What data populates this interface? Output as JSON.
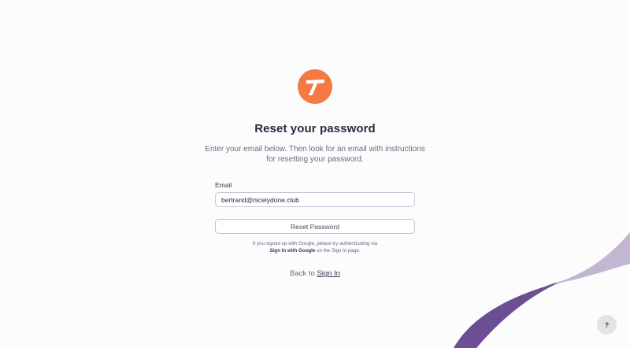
{
  "brand": {
    "logo_icon": "t-logo-icon",
    "accent_color": "#f47a45",
    "swoosh_dark_color": "#6b4e94",
    "swoosh_light_color": "#c2b6d3"
  },
  "header": {
    "title": "Reset your password",
    "subtitle": "Enter your email below. Then look for an email with instructions for resetting your password."
  },
  "form": {
    "email_label": "Email",
    "email_value": "bertrand@nicelydone.club",
    "submit_label": "Reset Password"
  },
  "google_note": {
    "line1": "If you signed up with Google, please try authenticating via",
    "emphasis": "Sign In with Google",
    "line2_rest": " on the Sign In page."
  },
  "footer": {
    "back_prefix": "Back to ",
    "sign_in_link": "Sign In"
  },
  "help": {
    "icon": "help-icon",
    "glyph": "?"
  }
}
